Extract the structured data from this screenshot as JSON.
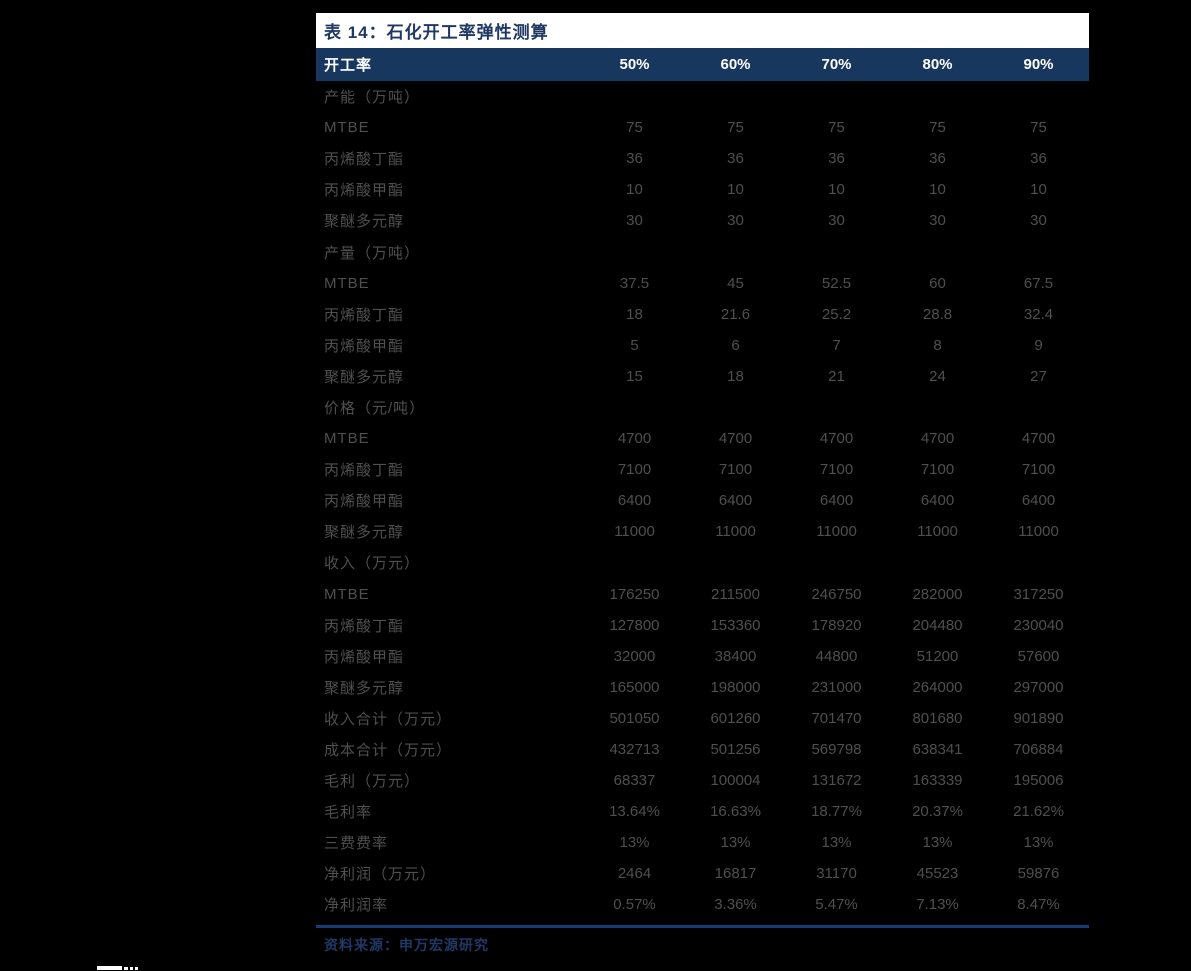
{
  "table": {
    "title": "表 14：石化开工率弹性测算",
    "header": {
      "label": "开工率",
      "columns": [
        "50%",
        "60%",
        "70%",
        "80%",
        "90%"
      ]
    },
    "rows": [
      {
        "label": "产能（万吨）",
        "section": true,
        "values": [
          "",
          "",
          "",
          "",
          ""
        ]
      },
      {
        "label": "MTBE",
        "section": false,
        "values": [
          "75",
          "75",
          "75",
          "75",
          "75"
        ]
      },
      {
        "label": "丙烯酸丁酯",
        "section": false,
        "values": [
          "36",
          "36",
          "36",
          "36",
          "36"
        ]
      },
      {
        "label": "丙烯酸甲酯",
        "section": false,
        "values": [
          "10",
          "10",
          "10",
          "10",
          "10"
        ]
      },
      {
        "label": "聚醚多元醇",
        "section": false,
        "values": [
          "30",
          "30",
          "30",
          "30",
          "30"
        ]
      },
      {
        "label": "产量（万吨）",
        "section": true,
        "values": [
          "",
          "",
          "",
          "",
          ""
        ]
      },
      {
        "label": "MTBE",
        "section": false,
        "values": [
          "37.5",
          "45",
          "52.5",
          "60",
          "67.5"
        ]
      },
      {
        "label": "丙烯酸丁酯",
        "section": false,
        "values": [
          "18",
          "21.6",
          "25.2",
          "28.8",
          "32.4"
        ]
      },
      {
        "label": "丙烯酸甲酯",
        "section": false,
        "values": [
          "5",
          "6",
          "7",
          "8",
          "9"
        ]
      },
      {
        "label": "聚醚多元醇",
        "section": false,
        "values": [
          "15",
          "18",
          "21",
          "24",
          "27"
        ]
      },
      {
        "label": "价格（元/吨）",
        "section": true,
        "values": [
          "",
          "",
          "",
          "",
          ""
        ]
      },
      {
        "label": "MTBE",
        "section": false,
        "values": [
          "4700",
          "4700",
          "4700",
          "4700",
          "4700"
        ]
      },
      {
        "label": "丙烯酸丁酯",
        "section": false,
        "values": [
          "7100",
          "7100",
          "7100",
          "7100",
          "7100"
        ]
      },
      {
        "label": "丙烯酸甲酯",
        "section": false,
        "values": [
          "6400",
          "6400",
          "6400",
          "6400",
          "6400"
        ]
      },
      {
        "label": "聚醚多元醇",
        "section": false,
        "values": [
          "11000",
          "11000",
          "11000",
          "11000",
          "11000"
        ]
      },
      {
        "label": "收入（万元）",
        "section": true,
        "values": [
          "",
          "",
          "",
          "",
          ""
        ]
      },
      {
        "label": "MTBE",
        "section": false,
        "values": [
          "176250",
          "211500",
          "246750",
          "282000",
          "317250"
        ]
      },
      {
        "label": "丙烯酸丁酯",
        "section": false,
        "values": [
          "127800",
          "153360",
          "178920",
          "204480",
          "230040"
        ]
      },
      {
        "label": "丙烯酸甲酯",
        "section": false,
        "values": [
          "32000",
          "38400",
          "44800",
          "51200",
          "57600"
        ]
      },
      {
        "label": "聚醚多元醇",
        "section": false,
        "values": [
          "165000",
          "198000",
          "231000",
          "264000",
          "297000"
        ]
      },
      {
        "label": "收入合计（万元）",
        "section": false,
        "values": [
          "501050",
          "601260",
          "701470",
          "801680",
          "901890"
        ]
      },
      {
        "label": "成本合计（万元）",
        "section": false,
        "values": [
          "432713",
          "501256",
          "569798",
          "638341",
          "706884"
        ]
      },
      {
        "label": "毛利（万元）",
        "section": false,
        "values": [
          "68337",
          "100004",
          "131672",
          "163339",
          "195006"
        ]
      },
      {
        "label": "毛利率",
        "section": false,
        "values": [
          "13.64%",
          "16.63%",
          "18.77%",
          "20.37%",
          "21.62%"
        ]
      },
      {
        "label": "三费费率",
        "section": false,
        "values": [
          "13%",
          "13%",
          "13%",
          "13%",
          "13%"
        ]
      },
      {
        "label": "净利润（万元）",
        "section": false,
        "values": [
          "2464",
          "16817",
          "31170",
          "45523",
          "59876"
        ]
      },
      {
        "label": "净利润率",
        "section": false,
        "values": [
          "0.57%",
          "3.36%",
          "5.47%",
          "7.13%",
          "8.47%"
        ]
      }
    ],
    "source": "资料来源：申万宏源研究"
  },
  "colors": {
    "page_bg": "#000000",
    "title_bg": "#FFFFFF",
    "title_text": "#1F3864",
    "header_bg": "#17375E",
    "header_text": "#FFFFFF",
    "body_text": "#4F4F4F",
    "divider": "#143D73",
    "source_text": "#1F3864"
  }
}
